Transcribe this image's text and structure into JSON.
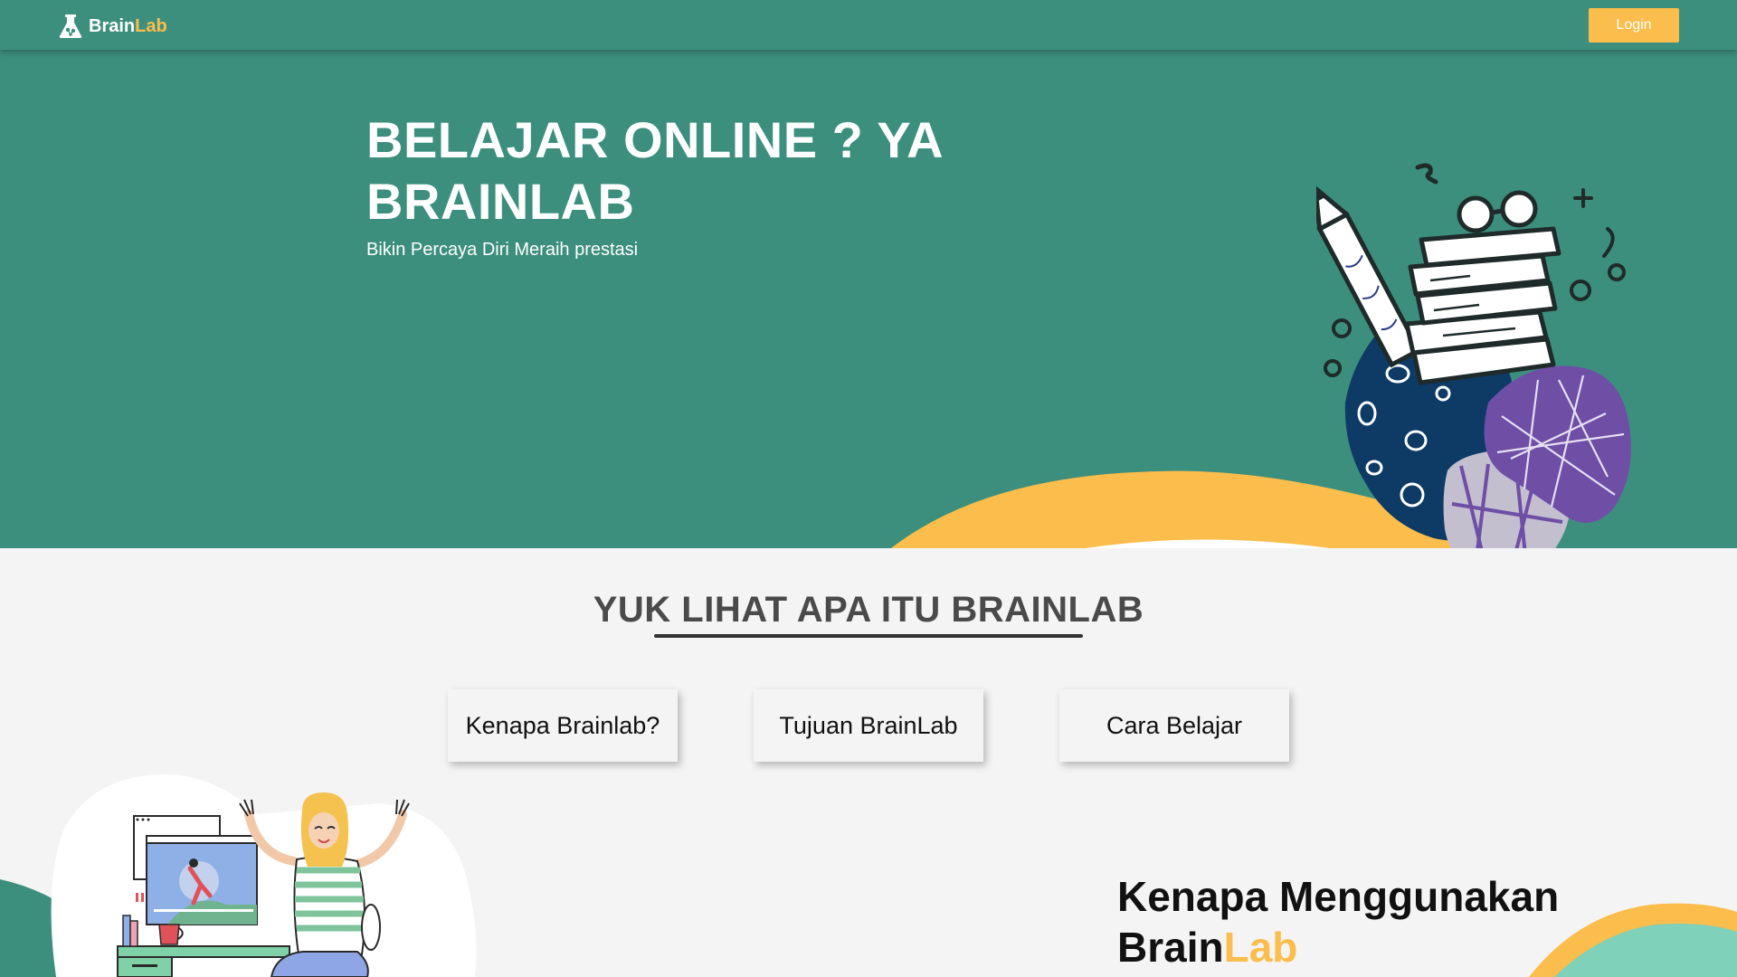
{
  "navbar": {
    "brand_part1": "Brain",
    "brand_part2": "Lab",
    "login_label": "Login"
  },
  "hero": {
    "title": "BELAJAR ONLINE ? YA BRAINLAB",
    "subtitle": "Bikin Percaya Diri Meraih prestasi"
  },
  "section": {
    "title": "YUK LIHAT APA ITU BRAINLAB"
  },
  "tabs": [
    {
      "label": "Kenapa Brainlab?"
    },
    {
      "label": "Tujuan BrainLab"
    },
    {
      "label": "Cara Belajar"
    }
  ],
  "feature": {
    "title_part1": "Kenapa Menggunakan",
    "title_part2": "Brain",
    "title_part3": "Lab"
  },
  "colors": {
    "primary": "#3d8f7d",
    "accent": "#fbbd4b",
    "background": "#f4f4f4",
    "mint": "#7fd1b9"
  },
  "icons": {
    "brand": "flask-brain-icon"
  }
}
